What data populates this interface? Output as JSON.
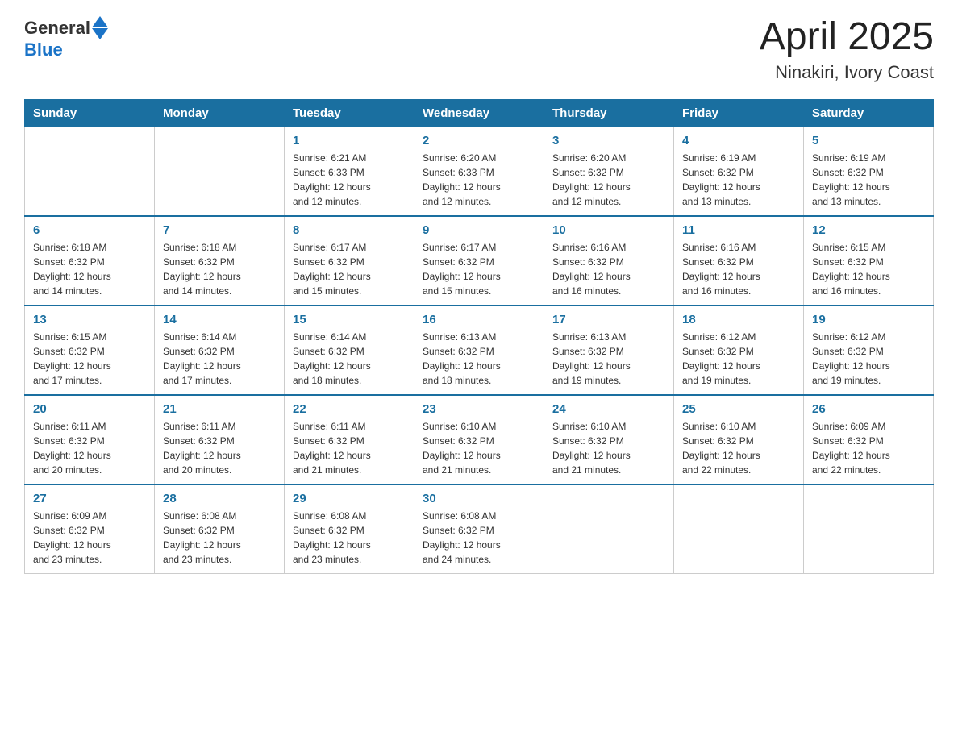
{
  "header": {
    "logo_general": "General",
    "logo_blue": "Blue",
    "title": "April 2025",
    "location": "Ninakiri, Ivory Coast"
  },
  "days_of_week": [
    "Sunday",
    "Monday",
    "Tuesday",
    "Wednesday",
    "Thursday",
    "Friday",
    "Saturday"
  ],
  "weeks": [
    [
      {
        "day": "",
        "info": ""
      },
      {
        "day": "",
        "info": ""
      },
      {
        "day": "1",
        "info": "Sunrise: 6:21 AM\nSunset: 6:33 PM\nDaylight: 12 hours\nand 12 minutes."
      },
      {
        "day": "2",
        "info": "Sunrise: 6:20 AM\nSunset: 6:33 PM\nDaylight: 12 hours\nand 12 minutes."
      },
      {
        "day": "3",
        "info": "Sunrise: 6:20 AM\nSunset: 6:32 PM\nDaylight: 12 hours\nand 12 minutes."
      },
      {
        "day": "4",
        "info": "Sunrise: 6:19 AM\nSunset: 6:32 PM\nDaylight: 12 hours\nand 13 minutes."
      },
      {
        "day": "5",
        "info": "Sunrise: 6:19 AM\nSunset: 6:32 PM\nDaylight: 12 hours\nand 13 minutes."
      }
    ],
    [
      {
        "day": "6",
        "info": "Sunrise: 6:18 AM\nSunset: 6:32 PM\nDaylight: 12 hours\nand 14 minutes."
      },
      {
        "day": "7",
        "info": "Sunrise: 6:18 AM\nSunset: 6:32 PM\nDaylight: 12 hours\nand 14 minutes."
      },
      {
        "day": "8",
        "info": "Sunrise: 6:17 AM\nSunset: 6:32 PM\nDaylight: 12 hours\nand 15 minutes."
      },
      {
        "day": "9",
        "info": "Sunrise: 6:17 AM\nSunset: 6:32 PM\nDaylight: 12 hours\nand 15 minutes."
      },
      {
        "day": "10",
        "info": "Sunrise: 6:16 AM\nSunset: 6:32 PM\nDaylight: 12 hours\nand 16 minutes."
      },
      {
        "day": "11",
        "info": "Sunrise: 6:16 AM\nSunset: 6:32 PM\nDaylight: 12 hours\nand 16 minutes."
      },
      {
        "day": "12",
        "info": "Sunrise: 6:15 AM\nSunset: 6:32 PM\nDaylight: 12 hours\nand 16 minutes."
      }
    ],
    [
      {
        "day": "13",
        "info": "Sunrise: 6:15 AM\nSunset: 6:32 PM\nDaylight: 12 hours\nand 17 minutes."
      },
      {
        "day": "14",
        "info": "Sunrise: 6:14 AM\nSunset: 6:32 PM\nDaylight: 12 hours\nand 17 minutes."
      },
      {
        "day": "15",
        "info": "Sunrise: 6:14 AM\nSunset: 6:32 PM\nDaylight: 12 hours\nand 18 minutes."
      },
      {
        "day": "16",
        "info": "Sunrise: 6:13 AM\nSunset: 6:32 PM\nDaylight: 12 hours\nand 18 minutes."
      },
      {
        "day": "17",
        "info": "Sunrise: 6:13 AM\nSunset: 6:32 PM\nDaylight: 12 hours\nand 19 minutes."
      },
      {
        "day": "18",
        "info": "Sunrise: 6:12 AM\nSunset: 6:32 PM\nDaylight: 12 hours\nand 19 minutes."
      },
      {
        "day": "19",
        "info": "Sunrise: 6:12 AM\nSunset: 6:32 PM\nDaylight: 12 hours\nand 19 minutes."
      }
    ],
    [
      {
        "day": "20",
        "info": "Sunrise: 6:11 AM\nSunset: 6:32 PM\nDaylight: 12 hours\nand 20 minutes."
      },
      {
        "day": "21",
        "info": "Sunrise: 6:11 AM\nSunset: 6:32 PM\nDaylight: 12 hours\nand 20 minutes."
      },
      {
        "day": "22",
        "info": "Sunrise: 6:11 AM\nSunset: 6:32 PM\nDaylight: 12 hours\nand 21 minutes."
      },
      {
        "day": "23",
        "info": "Sunrise: 6:10 AM\nSunset: 6:32 PM\nDaylight: 12 hours\nand 21 minutes."
      },
      {
        "day": "24",
        "info": "Sunrise: 6:10 AM\nSunset: 6:32 PM\nDaylight: 12 hours\nand 21 minutes."
      },
      {
        "day": "25",
        "info": "Sunrise: 6:10 AM\nSunset: 6:32 PM\nDaylight: 12 hours\nand 22 minutes."
      },
      {
        "day": "26",
        "info": "Sunrise: 6:09 AM\nSunset: 6:32 PM\nDaylight: 12 hours\nand 22 minutes."
      }
    ],
    [
      {
        "day": "27",
        "info": "Sunrise: 6:09 AM\nSunset: 6:32 PM\nDaylight: 12 hours\nand 23 minutes."
      },
      {
        "day": "28",
        "info": "Sunrise: 6:08 AM\nSunset: 6:32 PM\nDaylight: 12 hours\nand 23 minutes."
      },
      {
        "day": "29",
        "info": "Sunrise: 6:08 AM\nSunset: 6:32 PM\nDaylight: 12 hours\nand 23 minutes."
      },
      {
        "day": "30",
        "info": "Sunrise: 6:08 AM\nSunset: 6:32 PM\nDaylight: 12 hours\nand 24 minutes."
      },
      {
        "day": "",
        "info": ""
      },
      {
        "day": "",
        "info": ""
      },
      {
        "day": "",
        "info": ""
      }
    ]
  ]
}
